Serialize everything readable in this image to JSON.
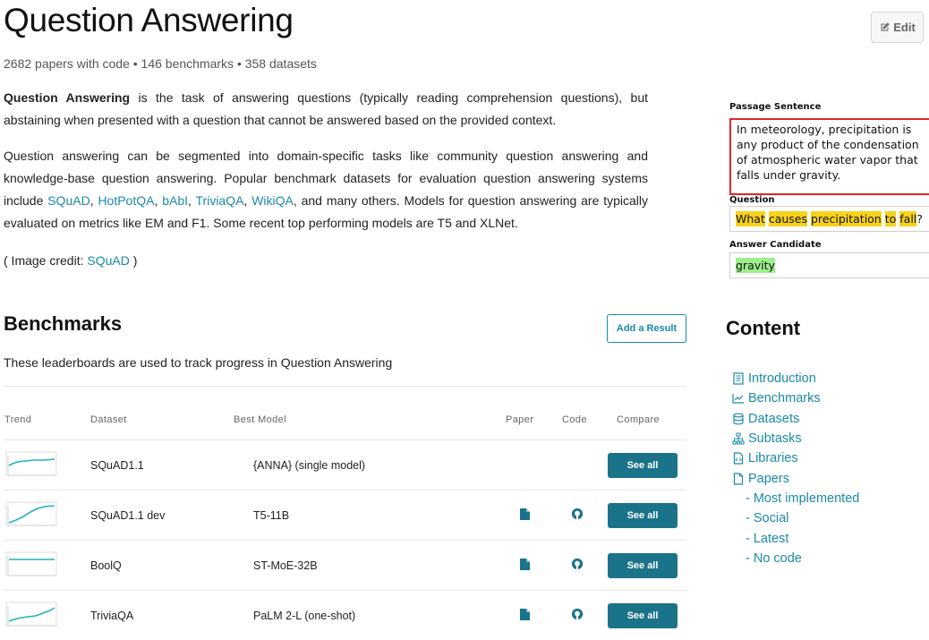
{
  "header": {
    "title": "Question Answering",
    "edit_label": "Edit",
    "stats": "2682 papers with code • 146 benchmarks • 358 datasets"
  },
  "description": {
    "p1_bold": "Question Answering",
    "p1_rest": " is the task of answering questions (typically reading comprehension questions), but abstaining when presented with a question that cannot be answered based on the provided context.",
    "p2_start": "Question answering can be segmented into domain-specific tasks like community question answering and knowledge-base question answering. Popular benchmark datasets for evaluation question answering systems include ",
    "links": [
      "SQuAD",
      "HotPotQA",
      "bAbI",
      "TriviaQA",
      "WikiQA"
    ],
    "sep": ", ",
    "p2_end": ", and many others. Models for question answering are typically evaluated on metrics like EM and F1. Some recent top performing models are T5 and XLNet.",
    "credit_prefix": "( Image credit: ",
    "credit_link": "SQuAD",
    "credit_suffix": " )"
  },
  "figure": {
    "passage_label": "Passage Sentence",
    "passage_text": "In meteorology, precipitation is any product of the condensation of atmospheric water vapor that falls under gravity.",
    "question_label": "Question",
    "q_words": [
      "What",
      "causes",
      "precipitation",
      "to",
      "fall"
    ],
    "q_end": "?",
    "answer_label": "Answer Candidate",
    "answer_text": "gravity",
    "highlight_question": "#f7d21a",
    "highlight_answer": "#9eef8e",
    "passage_border": "#e0242b"
  },
  "benchmarks": {
    "title": "Benchmarks",
    "add_result_label": "Add a Result",
    "subtitle": "These leaderboards are used to track progress in Question Answering",
    "columns": [
      "Trend",
      "Dataset",
      "Best Model",
      "Paper",
      "Code",
      "Compare"
    ],
    "rows": [
      {
        "dataset": "SQuAD1.1",
        "model": "{ANNA} (single model)",
        "has_paper": false,
        "has_code": false,
        "compare": "See all"
      },
      {
        "dataset": "SQuAD1.1 dev",
        "model": "T5-11B",
        "has_paper": true,
        "has_code": true,
        "compare": "See all"
      },
      {
        "dataset": "BoolQ",
        "model": "ST-MoE-32B",
        "has_paper": true,
        "has_code": true,
        "compare": "See all"
      },
      {
        "dataset": "TriviaQA",
        "model": "PaLM 2-L (one-shot)",
        "has_paper": true,
        "has_code": true,
        "compare": "See all"
      }
    ]
  },
  "content": {
    "title": "Content",
    "items": [
      {
        "label": "Introduction",
        "icon": "book-icon",
        "sub": false
      },
      {
        "label": "Benchmarks",
        "icon": "chart-icon",
        "sub": false
      },
      {
        "label": "Datasets",
        "icon": "database-icon",
        "sub": false
      },
      {
        "label": "Subtasks",
        "icon": "sitemap-icon",
        "sub": false
      },
      {
        "label": "Libraries",
        "icon": "file-code-icon",
        "sub": false
      },
      {
        "label": "Papers",
        "icon": "file-icon",
        "sub": false
      },
      {
        "label": "- Most implemented",
        "icon": "",
        "sub": true
      },
      {
        "label": "- Social",
        "icon": "",
        "sub": true
      },
      {
        "label": "- Latest",
        "icon": "",
        "sub": true
      },
      {
        "label": "- No code",
        "icon": "",
        "sub": true
      }
    ]
  },
  "colors": {
    "link": "#1a8aa8",
    "button": "#1b7389",
    "trend_line": "#1fb3c2"
  }
}
